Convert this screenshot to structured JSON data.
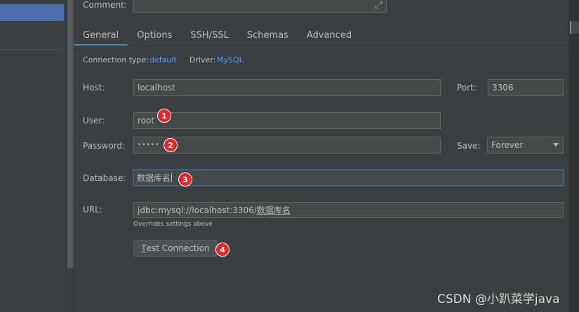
{
  "comment": {
    "label": "Comment:"
  },
  "tabs": [
    {
      "label": "General",
      "active": true
    },
    {
      "label": "Options",
      "active": false
    },
    {
      "label": "SSH/SSL",
      "active": false
    },
    {
      "label": "Schemas",
      "active": false
    },
    {
      "label": "Advanced",
      "active": false
    }
  ],
  "connection": {
    "type_label": "Connection type:",
    "type_value": "default",
    "driver_label": "Driver:",
    "driver_value": "MySQL"
  },
  "host": {
    "label": "Host:",
    "value": "localhost"
  },
  "port": {
    "label": "Port:",
    "value": "3306"
  },
  "user": {
    "label": "User:",
    "value": "root"
  },
  "password": {
    "label": "Password:",
    "value": "•••••"
  },
  "save": {
    "label": "Save:",
    "value": "Forever"
  },
  "database": {
    "label": "Database:",
    "value": "数据库名"
  },
  "url": {
    "label": "URL:",
    "value_prefix": "jdbc:mysql://localhost:3306/",
    "value_db": "数据库名",
    "hint": "Overrides settings above"
  },
  "test_button": {
    "mnemonic": "T",
    "rest": "est Connection"
  },
  "badges": [
    "1",
    "2",
    "3",
    "4"
  ],
  "watermark": "CSDN @小趴菜学java",
  "colors": {
    "accent": "#4a88c7",
    "link": "#589df6",
    "badge": "#e5262a",
    "selection": "#4b6eaf"
  }
}
